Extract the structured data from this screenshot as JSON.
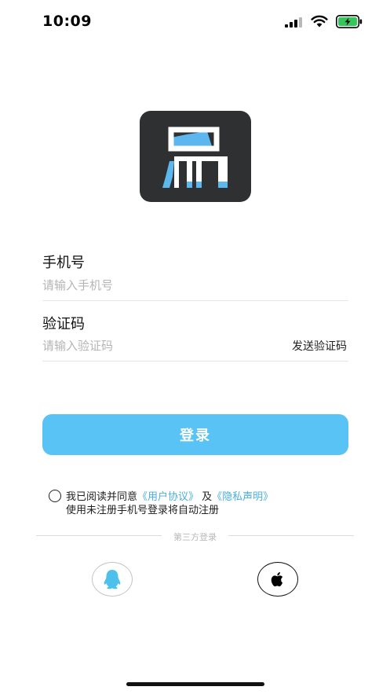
{
  "status_bar": {
    "time": "10:09"
  },
  "login": {
    "phone_label": "手机号",
    "phone_placeholder": "请输入手机号",
    "phone_value": "",
    "code_label": "验证码",
    "code_placeholder": "请输入验证码",
    "code_value": "",
    "send_code_label": "发送验证码",
    "login_button_label": "登录"
  },
  "agreement": {
    "prefix": "我已阅读并同意",
    "user_agreement": "《用户协议》",
    "conjunction": " 及",
    "privacy_statement": "《隐私声明》",
    "note": "使用未注册手机号登录将自动注册",
    "checked": false
  },
  "third_party": {
    "label": "第三方登录",
    "qq_icon": "qq-penguin-icon",
    "apple_icon": "apple-icon"
  },
  "colors": {
    "accent": "#5ac3f5",
    "link": "#4aaee0",
    "logo_bg": "#2e3031",
    "battery_green": "#34c759"
  }
}
